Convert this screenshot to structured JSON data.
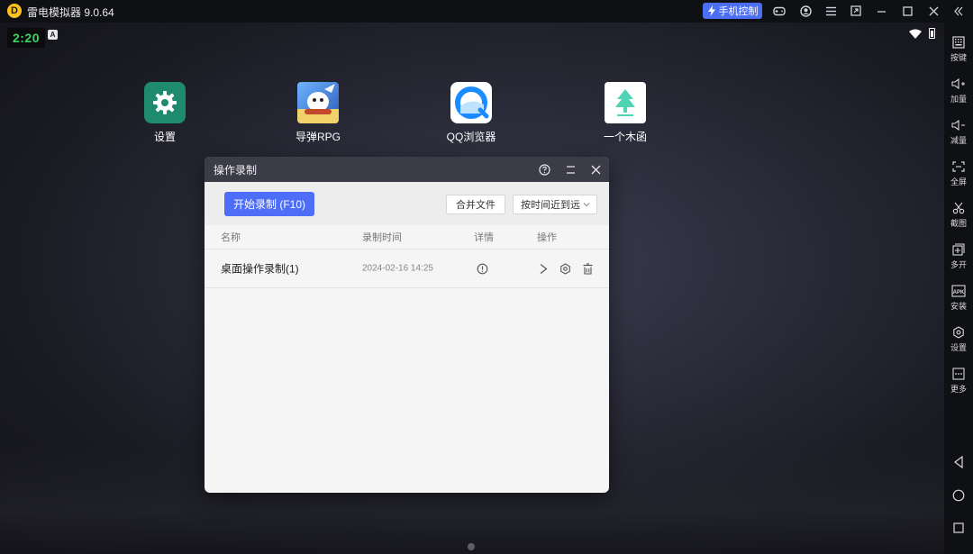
{
  "titlebar": {
    "app_title": "雷电模拟器 9.0.64",
    "phone_control": "手机控制",
    "buttons": [
      "gamepad-icon",
      "account-icon",
      "menu-icon",
      "screenshot-icon",
      "minimize-icon",
      "maximize-icon",
      "close-icon"
    ]
  },
  "statusbar": {
    "clock": "2:20",
    "badge": "A"
  },
  "desktop": {
    "apps": [
      {
        "label": "设置"
      },
      {
        "label": "导弹RPG"
      },
      {
        "label": "QQ浏览器"
      },
      {
        "label": "一个木函"
      }
    ]
  },
  "dialog": {
    "title": "操作录制",
    "start_button": "开始录制 (F10)",
    "merge_button": "合并文件",
    "sort_select": "按时间近到远",
    "columns": {
      "name": "名称",
      "time": "录制时间",
      "detail": "详情",
      "action": "操作"
    },
    "rows": [
      {
        "name": "桌面操作录制(1)",
        "time": "2024-02-16 14:25"
      }
    ]
  },
  "sidebar": {
    "items": [
      {
        "label": "按键",
        "icon": "keyboard-icon"
      },
      {
        "label": "加量",
        "icon": "volume-up-icon"
      },
      {
        "label": "减量",
        "icon": "volume-down-icon"
      },
      {
        "label": "全屏",
        "icon": "fullscreen-icon"
      },
      {
        "label": "截图",
        "icon": "scissors-icon"
      },
      {
        "label": "多开",
        "icon": "multi-instance-icon"
      },
      {
        "label": "安装",
        "icon": "apk-install-icon"
      },
      {
        "label": "设置",
        "icon": "settings-icon"
      },
      {
        "label": "更多",
        "icon": "more-icon"
      }
    ]
  },
  "colors": {
    "accent": "#4f6ef7",
    "clock": "#3fd45f",
    "logo": "#ffc21a"
  }
}
